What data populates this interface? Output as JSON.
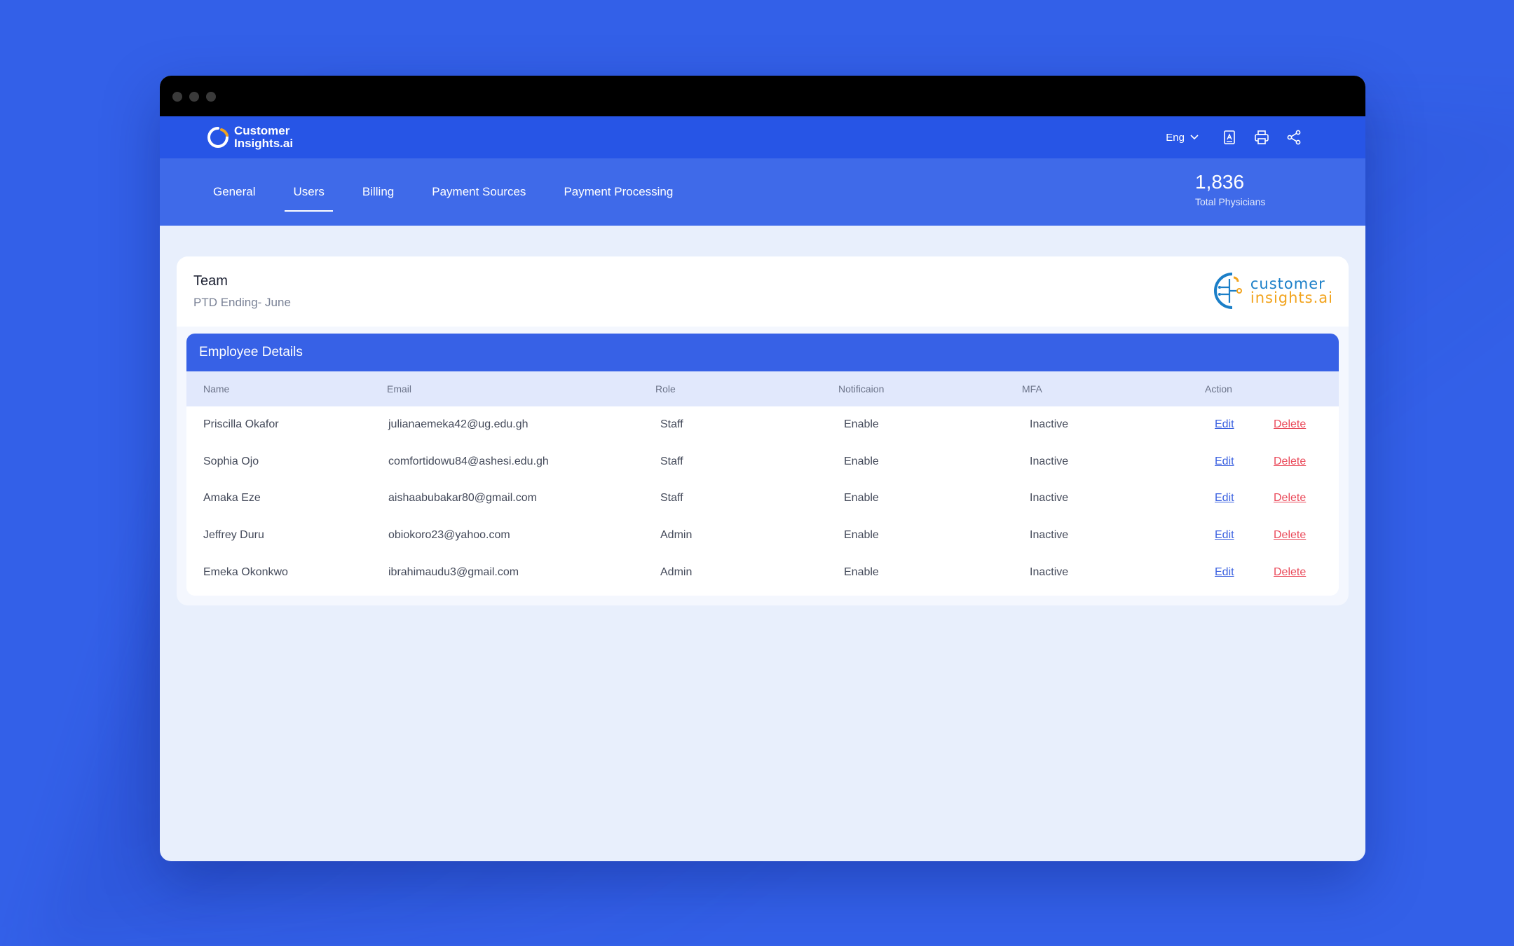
{
  "app": {
    "logo_line1": "Customer",
    "logo_line2": "Insights.ai",
    "language": "Eng",
    "icons": [
      "contact-icon",
      "print-icon",
      "share-icon"
    ]
  },
  "tabs": [
    {
      "label": "General",
      "active": false
    },
    {
      "label": "Users",
      "active": true
    },
    {
      "label": "Billing",
      "active": false
    },
    {
      "label": "Payment Sources",
      "active": false
    },
    {
      "label": "Payment Processing",
      "active": false
    }
  ],
  "stat": {
    "value": "1,836",
    "label": "Total  Physicians"
  },
  "card": {
    "title": "Team",
    "subtitle": "PTD Ending- June",
    "brand_line1": "customer",
    "brand_line2": "insights.ai"
  },
  "table": {
    "title": "Employee Details",
    "columns": [
      "Name",
      "Email",
      "Role",
      "Notificaion",
      "MFA",
      "Action"
    ],
    "rows": [
      {
        "name": "Priscilla Okafor",
        "email": "julianaemeka42@ug.edu.gh",
        "role": "Staff",
        "notification": "Enable",
        "mfa": "Inactive",
        "edit": "Edit",
        "delete": "Delete"
      },
      {
        "name": "Sophia Ojo",
        "email": "comfortidowu84@ashesi.edu.gh",
        "role": "Staff",
        "notification": "Enable",
        "mfa": "Inactive",
        "edit": "Edit",
        "delete": "Delete"
      },
      {
        "name": "Amaka Eze",
        "email": "aishaabubakar80@gmail.com",
        "role": "Staff",
        "notification": "Enable",
        "mfa": "Inactive",
        "edit": "Edit",
        "delete": "Delete"
      },
      {
        "name": "Jeffrey Duru",
        "email": "obiokoro23@yahoo.com",
        "role": "Admin",
        "notification": "Enable",
        "mfa": "Inactive",
        "edit": "Edit",
        "delete": "Delete"
      },
      {
        "name": "Emeka Okonkwo",
        "email": "ibrahimaudu3@gmail.com",
        "role": "Admin",
        "notification": "Enable",
        "mfa": "Inactive",
        "edit": "Edit",
        "delete": "Delete"
      }
    ]
  },
  "colors": {
    "background": "#3360e8",
    "topbar": "#2755e6",
    "tabsbar": "#3f6ae9",
    "table_header": "#3761e6",
    "edit_link": "#3b61e0",
    "delete_link": "#ea4a5a"
  }
}
